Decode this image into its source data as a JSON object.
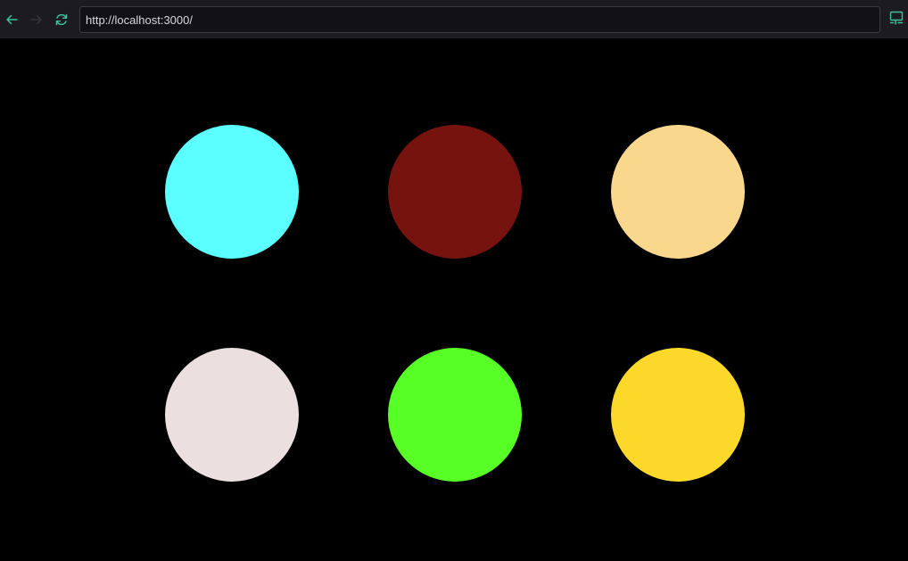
{
  "browser": {
    "url": "http://localhost:3000/",
    "icons": {
      "back": "arrow-left-icon",
      "forward": "arrow-right-icon",
      "reload": "reload-icon",
      "cast": "cast-icon"
    },
    "colors": {
      "toolbar_bg": "#1b1b20",
      "accent": "#3fbf9f",
      "disabled": "#34343a"
    }
  },
  "page": {
    "background": "#000000",
    "circles": [
      {
        "color": "#5bffff"
      },
      {
        "color": "#77130f"
      },
      {
        "color": "#f9d88d"
      },
      {
        "color": "#ebdfdf"
      },
      {
        "color": "#58ff26"
      },
      {
        "color": "#fbd829"
      }
    ]
  }
}
